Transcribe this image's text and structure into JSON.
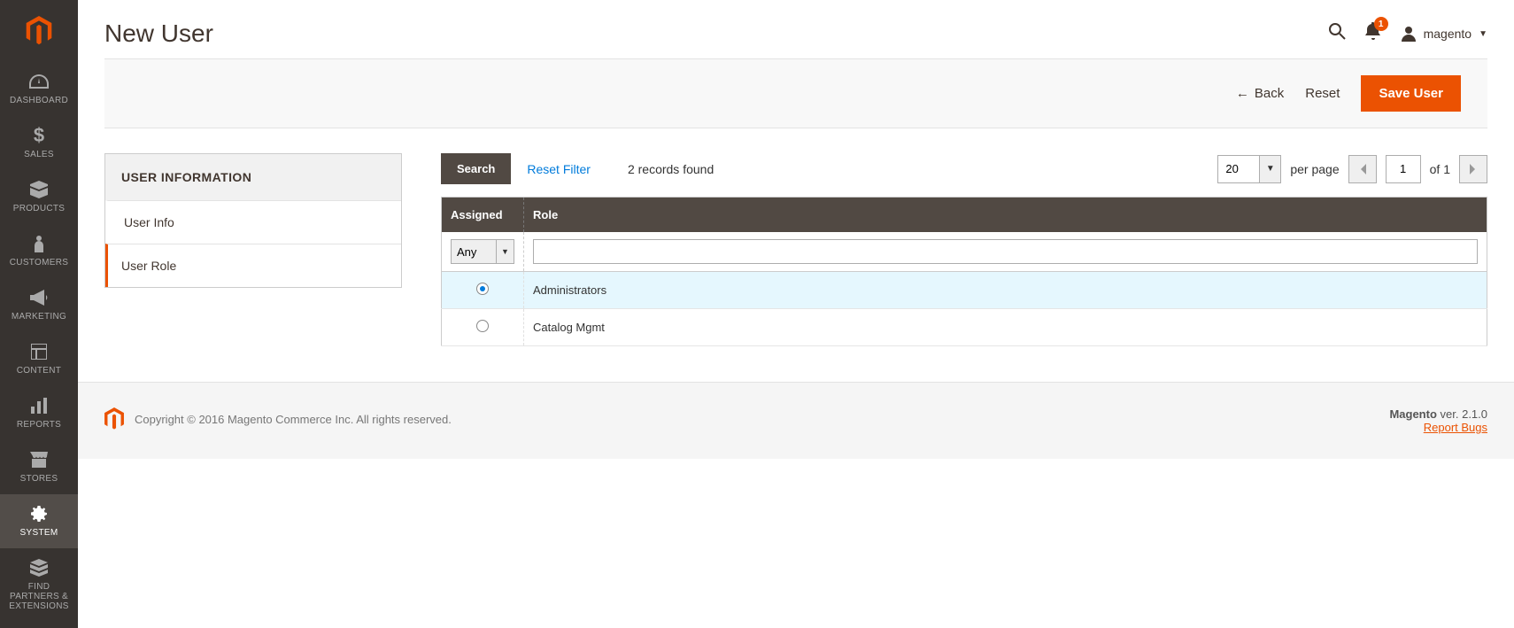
{
  "sidebar": {
    "items": [
      {
        "id": "dashboard",
        "label": "DASHBOARD"
      },
      {
        "id": "sales",
        "label": "SALES"
      },
      {
        "id": "products",
        "label": "PRODUCTS"
      },
      {
        "id": "customers",
        "label": "CUSTOMERS"
      },
      {
        "id": "marketing",
        "label": "MARKETING"
      },
      {
        "id": "content",
        "label": "CONTENT"
      },
      {
        "id": "reports",
        "label": "REPORTS"
      },
      {
        "id": "stores",
        "label": "STORES"
      },
      {
        "id": "system",
        "label": "SYSTEM"
      },
      {
        "id": "partners",
        "label": "FIND PARTNERS & EXTENSIONS"
      }
    ],
    "active": "system"
  },
  "header": {
    "title": "New User",
    "notifications_count": "1",
    "account_name": "magento"
  },
  "actions": {
    "back": "Back",
    "reset": "Reset",
    "save": "Save User"
  },
  "side_panel": {
    "title": "USER INFORMATION",
    "tabs": [
      {
        "id": "user-info",
        "label": "User Info"
      },
      {
        "id": "user-role",
        "label": "User Role"
      }
    ],
    "active": "user-role"
  },
  "grid": {
    "search_label": "Search",
    "reset_label": "Reset Filter",
    "records_text": "2 records found",
    "per_page_value": "20",
    "per_page_label": "per page",
    "page_current": "1",
    "page_of_label": "of",
    "page_total": "1",
    "columns": {
      "assigned": "Assigned",
      "role": "Role"
    },
    "filter_assigned_value": "Any",
    "filter_role_value": "",
    "rows": [
      {
        "selected": true,
        "role": "Administrators"
      },
      {
        "selected": false,
        "role": "Catalog Mgmt"
      }
    ]
  },
  "footer": {
    "copyright": "Copyright © 2016 Magento Commerce Inc. All rights reserved.",
    "version_prefix": "Magento",
    "version": " ver. 2.1.0",
    "report_bugs": "Report Bugs"
  }
}
